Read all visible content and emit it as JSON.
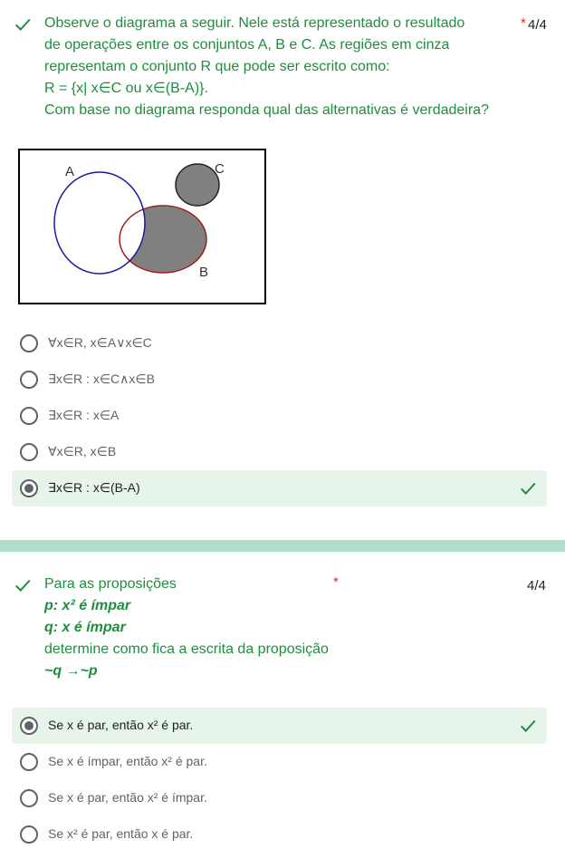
{
  "question1": {
    "prompt_lines": [
      "Observe o diagrama a seguir. Nele está representado o resultado",
      "de operações entre os conjuntos A, B e C. As regiões em cinza",
      "representam o conjunto R que pode ser escrito como:",
      "R = {x| x∈C ou x∈(B-A)}.",
      "Com base no diagrama responda qual das alternativas é verdadeira?"
    ],
    "required_mark": "*",
    "score": "4/4",
    "diagram": {
      "label_a": "A",
      "label_b": "B",
      "label_c": "C"
    },
    "options": [
      {
        "label": "∀x∈R, x∈A∨x∈C",
        "selected": false
      },
      {
        "label": "∃x∈R : x∈C∧x∈B",
        "selected": false
      },
      {
        "label": "∃x∈R : x∈A",
        "selected": false
      },
      {
        "label": "∀x∈R, x∈B",
        "selected": false
      },
      {
        "label": "∃x∈R : x∈(B-A)",
        "selected": true,
        "correct": true
      }
    ]
  },
  "question2": {
    "title": "Para as proposições",
    "p_line": "p: x² é ímpar",
    "q_line": "q: x é ímpar",
    "instruction": "determine como fica a escrita da proposição",
    "formula": "~q →~p",
    "required_mark": "*",
    "score": "4/4",
    "options": [
      {
        "label": "Se x é par, então x² é par.",
        "selected": true,
        "correct": true
      },
      {
        "label": "Se x é ímpar, então x² é par.",
        "selected": false
      },
      {
        "label": "Se x é par, então x² é ímpar.",
        "selected": false
      },
      {
        "label": "Se x² é par, então x é par.",
        "selected": false
      }
    ]
  },
  "colors": {
    "accent_green": "#1e8e3e",
    "selected_bg": "#e6f4ea",
    "divider": "#b1dec9",
    "required_red": "#d93025",
    "set_a_stroke": "#1a1aa0",
    "set_b_stroke": "#a01c1c",
    "region_gray": "#808080"
  },
  "icons": {
    "correct": "checkmark-icon",
    "radio_on": "radio-selected-icon",
    "radio_off": "radio-unselected-icon"
  }
}
